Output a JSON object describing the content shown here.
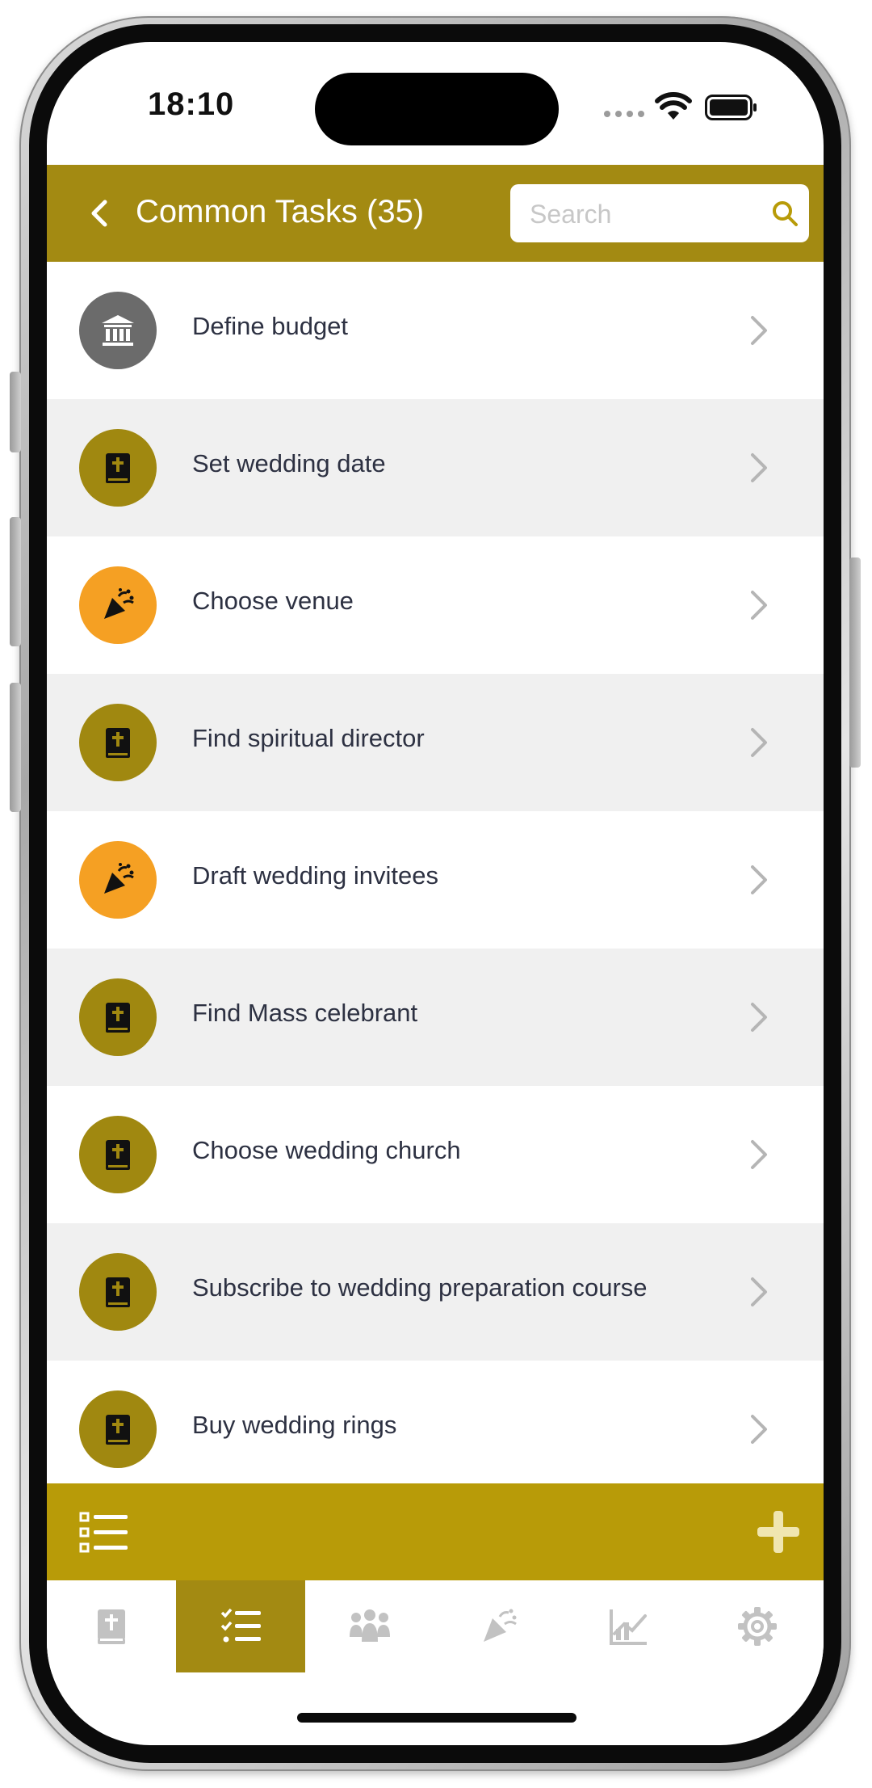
{
  "status_bar": {
    "time": "18:10"
  },
  "header": {
    "title": "Common Tasks (35)",
    "search_placeholder": "Search",
    "search_value": ""
  },
  "colors": {
    "header_gold": "#a38a12",
    "toolbar_gold": "#b89b08",
    "icon_gray": "#6b6b6b",
    "icon_olive": "#a08810",
    "icon_orange": "#f5a023",
    "text_dark": "#2d3142"
  },
  "tasks": [
    {
      "label": "Define budget",
      "icon": "bank-icon"
    },
    {
      "label": "Set wedding date",
      "icon": "bible-icon"
    },
    {
      "label": "Choose venue",
      "icon": "party-popper-icon"
    },
    {
      "label": "Find spiritual director",
      "icon": "bible-icon"
    },
    {
      "label": "Draft wedding invitees",
      "icon": "party-popper-icon"
    },
    {
      "label": "Find Mass celebrant",
      "icon": "bible-icon"
    },
    {
      "label": "Choose wedding church",
      "icon": "bible-icon"
    },
    {
      "label": "Subscribe to wedding preparation course",
      "icon": "bible-icon"
    },
    {
      "label": "Buy wedding rings",
      "icon": "bible-icon"
    }
  ],
  "toolbar": {
    "left_icon": "list-icon",
    "right_icon": "plus-icon"
  },
  "tabs": [
    {
      "icon": "bible-icon",
      "active": false
    },
    {
      "icon": "checklist-icon",
      "active": true
    },
    {
      "icon": "people-icon",
      "active": false
    },
    {
      "icon": "party-popper-icon",
      "active": false
    },
    {
      "icon": "chart-icon",
      "active": false
    },
    {
      "icon": "gear-icon",
      "active": false
    }
  ]
}
